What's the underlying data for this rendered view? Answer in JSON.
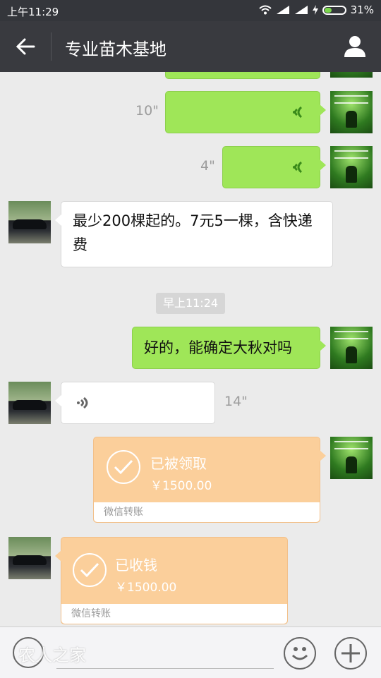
{
  "status_bar": {
    "time": "上午11:29",
    "battery": "31%",
    "battery_level": 0.31
  },
  "header": {
    "title": "专业苗木基地"
  },
  "messages": {
    "voice1": {
      "duration": "10\""
    },
    "voice2": {
      "duration": "4\""
    },
    "text1": {
      "text": "最少200棵起的。7元5一棵，含快递费"
    },
    "timestamp": "早上11:24",
    "text2": {
      "text": "好的，能确定大秋对吗"
    },
    "voice3": {
      "duration": "14\""
    },
    "transfer1": {
      "status": "已被领取",
      "amount": "￥1500.00",
      "label": "微信转账"
    },
    "transfer2": {
      "status": "已收钱",
      "amount": "￥1500.00",
      "label": "微信转账"
    }
  },
  "input_bar": {
    "watermark": "农人之家"
  },
  "colors": {
    "sent_bubble": "#9fe658",
    "transfer_bubble": "#fbcf9b",
    "header": "#393a3f"
  },
  "icons": [
    "back-arrow-icon",
    "person-icon",
    "voice-wave-icon",
    "check-icon",
    "voice-input-icon",
    "emoji-icon",
    "plus-icon",
    "wifi-icon",
    "signal-icon",
    "battery-icon"
  ]
}
